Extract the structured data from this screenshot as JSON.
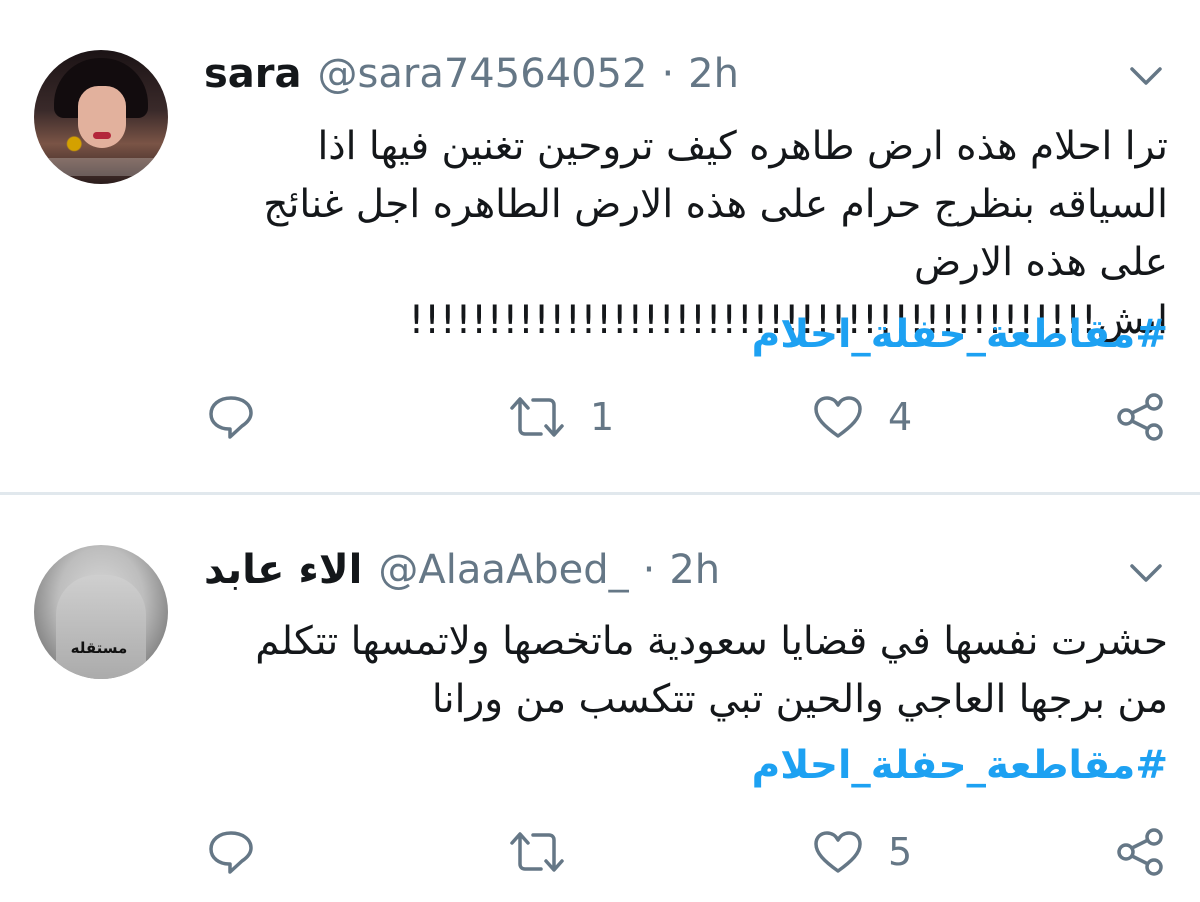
{
  "tweets": [
    {
      "display_name": "sara",
      "handle": "@sara74564052",
      "separator": "·",
      "time": "2h",
      "text_lines": [
        "ترا احلام هذه ارض طاهره كيف تروحين تغنين فيها اذا",
        "السياقه بنظرج حرام على هذه الارض الطاهره اجل غنائج",
        "على هذه الارض ايش!!!!!!!!!!!!!!!!!!!!!!!!!!!!!!!!!!!!!!!!!!!!"
      ],
      "hashtag": "#مقاطعة_حفلة_احلام",
      "reply_icon": "reply-icon",
      "retweet_count": "1",
      "like_count": "4",
      "share_icon": "share-icon"
    },
    {
      "display_name": "الاء عابد",
      "handle": "@AlaaAbed_",
      "separator": "·",
      "time": "2h",
      "avatar_text": "مستقله",
      "text_lines": [
        "حشرت نفسها في قضايا سعودية ماتخصها ولاتمسها تتكلم",
        "من برجها العاجي والحين تبي تتكسب من ورانا"
      ],
      "hashtag": "#مقاطعة_حفلة_احلام",
      "reply_icon": "reply-icon",
      "retweet_count": "",
      "like_count": "5",
      "share_icon": "share-icon"
    }
  ],
  "colors": {
    "text": "#14171a",
    "secondary": "#657786",
    "link": "#1da1f2",
    "divider": "#e1e8ed"
  }
}
